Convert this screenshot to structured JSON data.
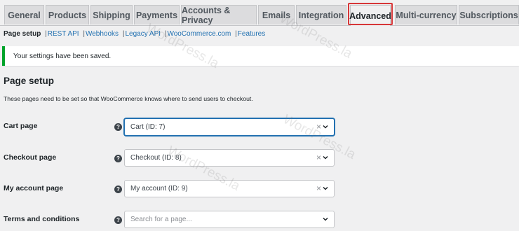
{
  "tabs": [
    {
      "label": "General"
    },
    {
      "label": "Products"
    },
    {
      "label": "Shipping"
    },
    {
      "label": "Payments"
    },
    {
      "label": "Accounts & Privacy"
    },
    {
      "label": "Emails"
    },
    {
      "label": "Integration"
    },
    {
      "label": "Advanced",
      "active": true
    },
    {
      "label": "Multi-currency"
    },
    {
      "label": "Subscriptions"
    }
  ],
  "subnav": {
    "current": "Page setup",
    "links": [
      "REST API",
      "Webhooks",
      "Legacy API",
      "WooCommerce.com",
      "Features"
    ],
    "separator": "|"
  },
  "notice": {
    "text": "Your settings have been saved."
  },
  "section": {
    "title": "Page setup",
    "description": "These pages need to be set so that WooCommerce knows where to send users to checkout."
  },
  "fields": [
    {
      "label": "Cart page",
      "value": "Cart (ID: 7)",
      "help": "?",
      "clear": "×"
    },
    {
      "label": "Checkout page",
      "value": "Checkout (ID: 8)",
      "help": "?",
      "clear": "×"
    },
    {
      "label": "My account page",
      "value": "My account (ID: 9)",
      "help": "?",
      "clear": "×"
    },
    {
      "label": "Terms and conditions",
      "placeholder": "Search for a page...",
      "help": "?"
    }
  ],
  "watermark": "WordPress.la",
  "colors": {
    "accent": "#2271b1",
    "success": "#00a32a",
    "highlight": "#d63638"
  }
}
